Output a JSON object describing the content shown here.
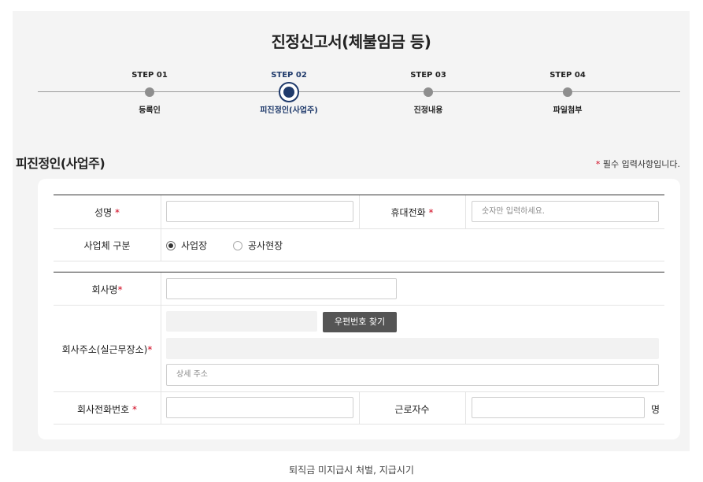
{
  "form": {
    "title": "진정신고서(체불임금 등)",
    "steps": [
      {
        "num": "STEP 01",
        "label": "등록인",
        "state": "done"
      },
      {
        "num": "STEP 02",
        "label": "피진정인(사업주)",
        "state": "current"
      },
      {
        "num": "STEP 03",
        "label": "진정내용",
        "state": "pending"
      },
      {
        "num": "STEP 04",
        "label": "파일첨부",
        "state": "pending"
      }
    ],
    "section_title": "피진정인(사업주)",
    "required_note": {
      "star": "*",
      "text": " 필수 입력사항입니다."
    },
    "star": "*",
    "fields": {
      "name_label": "성명",
      "mobile_label": "휴대전화",
      "mobile_placeholder": "숫자만 입력하세요.",
      "biz_type_label": "사업체 구분",
      "biz_type_options": [
        "사업장",
        "공사현장"
      ],
      "biz_type_selected": "사업장",
      "company_label": "회사명",
      "address_label": "회사주소(실근무장소)",
      "zip_button": "우편번호 찾기",
      "address_detail_placeholder": "상세 주소",
      "company_phone_label": "회사전화번호",
      "workers_label": "근로자수",
      "workers_unit": "명"
    },
    "caption": "퇴직금 미지급시 처벌, 지급시기"
  },
  "colors": {
    "accent": "#1f3a6b",
    "required": "#d0021b",
    "button": "#555555",
    "panel_bg": "#f4f4f4"
  }
}
